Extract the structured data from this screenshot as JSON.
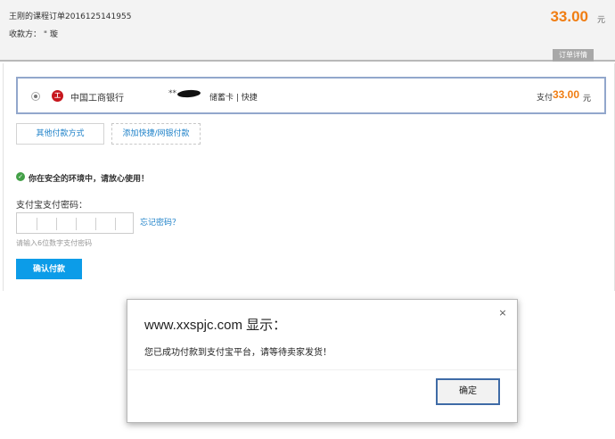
{
  "order": {
    "title": "王刚的课程订单2016125141955",
    "payee": "收款方： \" 璇",
    "amount": "33.00",
    "currency": "元",
    "detail_tab": "订单详情"
  },
  "bank": {
    "name": "中国工商银行",
    "logo_glyph": "工",
    "card_number": "**",
    "card_type": "储蓄卡 | 快捷",
    "pay_label": "支付",
    "pay_amount": "33.00",
    "pay_currency": "元"
  },
  "actions": {
    "other_method": "其他付款方式",
    "add_bank": "添加快捷/网银付款"
  },
  "security": {
    "icon": "check-circle",
    "text": "你在安全的环境中，请放心使用！"
  },
  "password": {
    "label": "支付宝支付密码：",
    "forgot": "忘记密码？",
    "hint": "请输入6位数字支付密码",
    "confirm": "确认付款"
  },
  "dialog": {
    "title": "www.xxspjc.com 显示：",
    "close": "×",
    "message": "您已成功付款到支付宝平台，请等待卖家发货！",
    "ok": "确定"
  },
  "colors": {
    "accent_orange": "#f07d12",
    "link_blue": "#1f82c9",
    "button_blue": "#0c9ce8",
    "bank_red": "#c7161d"
  }
}
